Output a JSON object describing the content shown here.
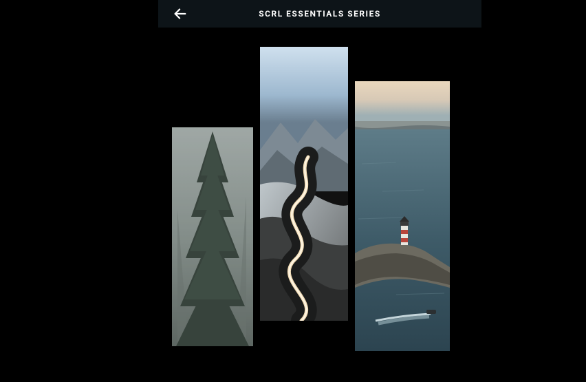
{
  "header": {
    "title": "SCRL ESSENTIALS SERIES",
    "back_icon": "arrow-left"
  },
  "panels": [
    {
      "name": "pine-tree-fog",
      "alt": "Misty evergreen pine tree"
    },
    {
      "name": "winding-road",
      "alt": "Snowy mountain winding road with light trails"
    },
    {
      "name": "coastal-sunset",
      "alt": "Coastal lighthouse and boat at sunset"
    }
  ],
  "colors": {
    "background": "#000000",
    "topbar": "#0d1418",
    "text": "#ffffff"
  }
}
